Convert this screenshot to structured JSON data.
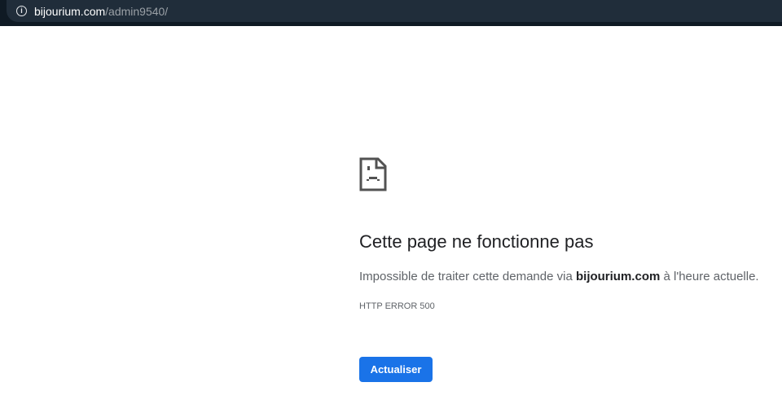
{
  "address_bar": {
    "domain": "bijourium.com",
    "path": "/admin9540/"
  },
  "error": {
    "title": "Cette page ne fonctionne pas",
    "desc_before": "Impossible de traiter cette demande via ",
    "desc_host": "bijourium.com",
    "desc_after": " à l'heure actuelle.",
    "code": "HTTP ERROR 500",
    "reload_label": "Actualiser"
  }
}
